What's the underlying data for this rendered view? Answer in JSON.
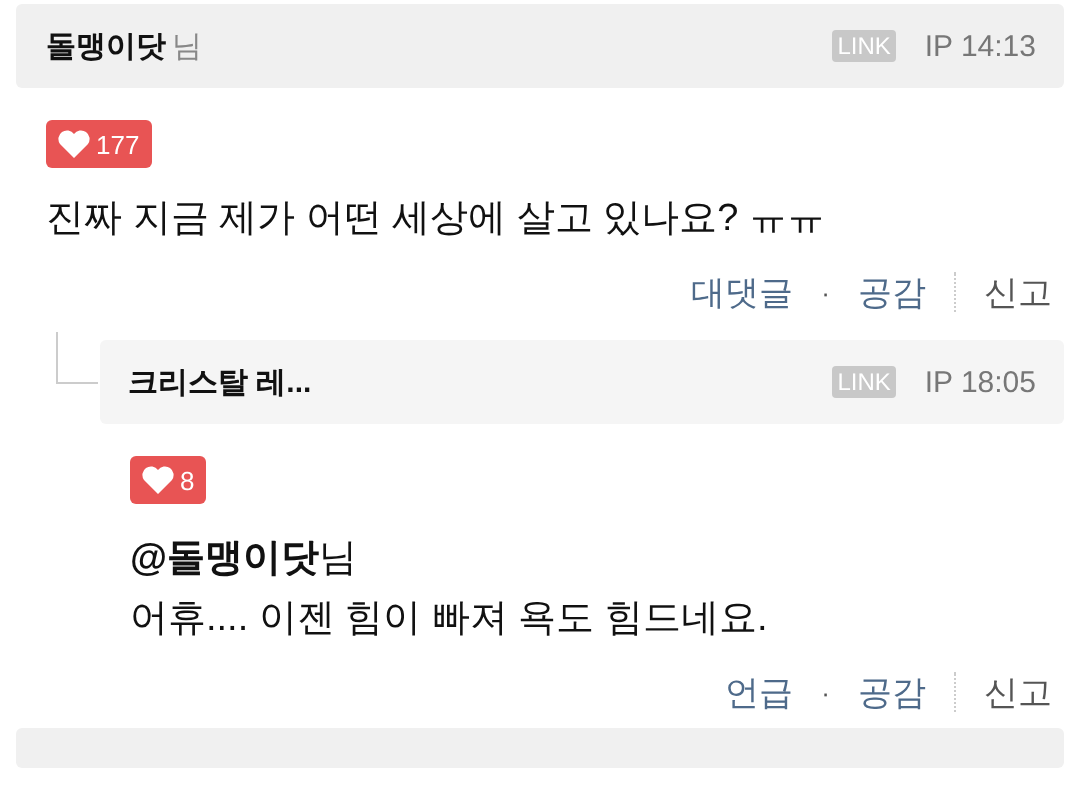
{
  "comments": [
    {
      "author": "돌맹이닷",
      "suffix": "님",
      "link_badge": "LINK",
      "ip_time": "IP 14:13",
      "likes": "177",
      "text": "진짜 지금 제가 어떤 세상에 살고 있나요? ㅠㅠ",
      "is_reply": false,
      "actions": [
        {
          "label": "대댓글",
          "kind": "link"
        },
        {
          "label": "·",
          "kind": "dot"
        },
        {
          "label": "공감",
          "kind": "link"
        },
        {
          "label": "신고",
          "kind": "report"
        }
      ]
    },
    {
      "author": "크리스탈 레...",
      "link_badge": "LINK",
      "ip_time": "IP 18:05",
      "likes": "8",
      "mention": "**@돌맹이닷**님",
      "text": "어휴.... 이젠 힘이 빠져 욕도 힘드네요.",
      "is_reply": true,
      "actions": [
        {
          "label": "언급",
          "kind": "link"
        },
        {
          "label": "·",
          "kind": "dot"
        },
        {
          "label": "공감",
          "kind": "link"
        },
        {
          "label": "신고",
          "kind": "report"
        }
      ]
    }
  ]
}
